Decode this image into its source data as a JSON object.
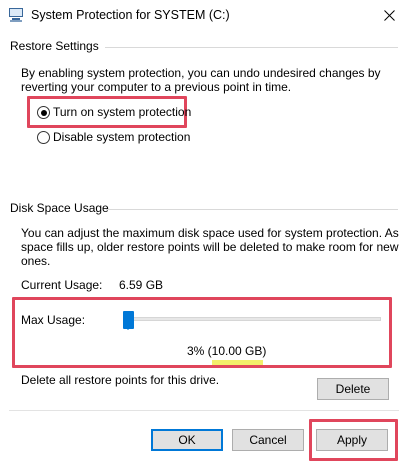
{
  "window": {
    "title": "System Protection for SYSTEM (C:)"
  },
  "restore_settings": {
    "heading": "Restore Settings",
    "description_line1": "By enabling system protection, you can undo undesired changes by",
    "description_line2": "reverting your computer to a previous point in time.",
    "options": [
      {
        "label": "Turn on system protection",
        "selected": true
      },
      {
        "label": "Disable system protection",
        "selected": false
      }
    ]
  },
  "disk_space": {
    "heading": "Disk Space Usage",
    "description_line1": "You can adjust the maximum disk space used for system protection. As",
    "description_line2": "space fills up, older restore points will be deleted to make room for new",
    "description_line3": "ones.",
    "current_usage_label": "Current Usage:",
    "current_usage_value": "6.59 GB",
    "max_usage_label": "Max Usage:",
    "max_usage_percent": 3,
    "max_usage_readout": "3% (10.00 GB)",
    "delete_text": "Delete all restore points for this drive.",
    "delete_button": "Delete"
  },
  "footer": {
    "ok": "OK",
    "cancel": "Cancel",
    "apply": "Apply"
  },
  "colors": {
    "highlight": "#e0465c",
    "accent": "#0078d7",
    "text_highlight": "#f3ef6b"
  },
  "icons": {
    "app": "system-properties-icon",
    "close": "close-icon"
  }
}
